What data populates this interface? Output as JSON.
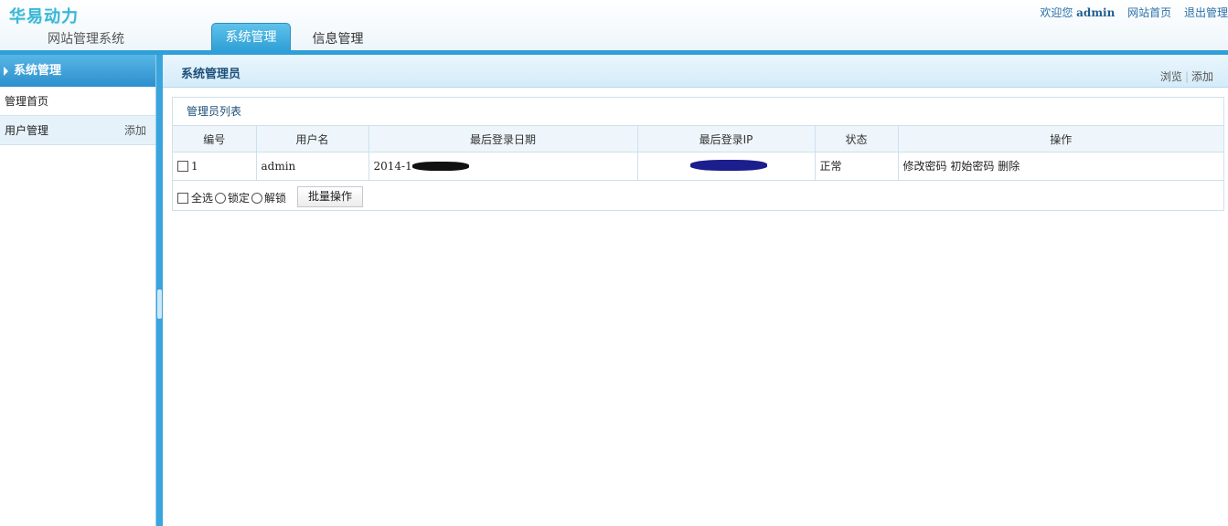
{
  "header": {
    "logo": "华易动力",
    "subtitle": "网站管理系统",
    "welcome_prefix": "欢迎您",
    "username": "admin",
    "home_link": "网站首页",
    "logout_link": "退出管理",
    "tabs": [
      {
        "label": "系统管理",
        "active": true
      },
      {
        "label": "信息管理",
        "active": false
      }
    ]
  },
  "sidebar": {
    "heading": "系统管理",
    "items": [
      {
        "label": "管理首页"
      },
      {
        "label": "用户管理",
        "action": "添加"
      }
    ]
  },
  "main": {
    "title": "系统管理员",
    "links": {
      "browse": "浏览",
      "add": "添加"
    },
    "panel_title": "管理员列表",
    "columns": [
      "编号",
      "用户名",
      "最后登录日期",
      "最后登录IP",
      "状态",
      "操作"
    ],
    "rows": [
      {
        "id": "1",
        "username": "admin",
        "last_login_date": "2014-1",
        "status": "正常",
        "actions": {
          "change_password": "修改密码",
          "reset_password": "初始密码",
          "delete": "删除"
        }
      }
    ],
    "bulk": {
      "select_all": "全选",
      "lock": "锁定",
      "unlock": "解锁",
      "batch_button": "批量操作"
    }
  },
  "colors": {
    "accent": "#2f9fd9",
    "logo": "#3bb8d6",
    "title": "#1d4f7a"
  }
}
